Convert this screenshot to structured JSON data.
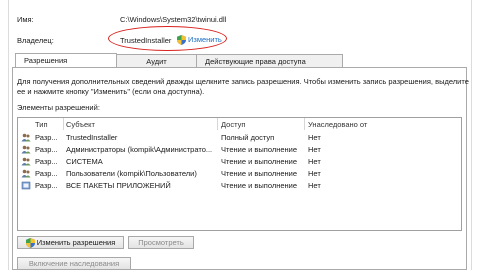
{
  "header": {
    "name_label": "Имя:",
    "name_value": "C:\\Windows\\System32\\twinui.dll",
    "owner_label": "Владелец:",
    "owner_value": "TrustedInstaller",
    "change_link": "Изменить"
  },
  "tabs": [
    {
      "label": "Разрешения",
      "active": true
    },
    {
      "label": "Аудит",
      "active": false
    },
    {
      "label": "Действующие права доступа",
      "active": false
    }
  ],
  "info_text_line1": "Для получения дополнительных сведений дважды щелкните запись разрешения. Чтобы изменить запись разрешения, выделите",
  "info_text_line2": "ее и нажмите кнопку \"Изменить\" (если она доступна).",
  "entries_label": "Элементы разрешений:",
  "table": {
    "columns": [
      "Тип",
      "Субъект",
      "Доступ",
      "Унаследовано от"
    ],
    "rows": [
      {
        "type": "Разр...",
        "subject": "TrustedInstaller",
        "access": "Полный доступ",
        "inherited": "Нет"
      },
      {
        "type": "Разр...",
        "subject": "Администраторы (kompik\\Администрато...",
        "access": "Чтение и выполнение",
        "inherited": "Нет"
      },
      {
        "type": "Разр...",
        "subject": "СИСТЕМА",
        "access": "Чтение и выполнение",
        "inherited": "Нет"
      },
      {
        "type": "Разр...",
        "subject": "Пользователи (kompik\\Пользователи)",
        "access": "Чтение и выполнение",
        "inherited": "Нет"
      },
      {
        "type": "Разр...",
        "subject": "ВСЕ ПАКЕТЫ ПРИЛОЖЕНИЙ",
        "access": "Чтение и выполнение",
        "inherited": "Нет"
      }
    ]
  },
  "buttons": {
    "change_permissions": "Изменить разрешения",
    "view": "Просмотреть",
    "enable_inheritance": "Включение наследования"
  },
  "colors": {
    "link": "#1a6fc4",
    "highlight_ellipse": "#d9211d"
  }
}
